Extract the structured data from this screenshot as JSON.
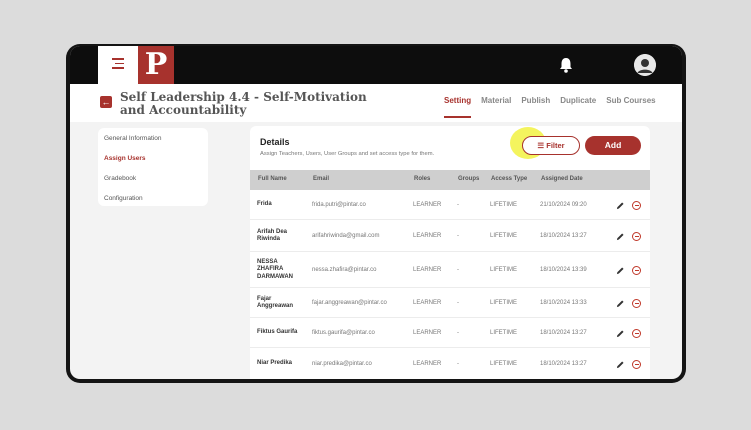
{
  "app": {
    "logo_letter": "P",
    "accent_color": "#a7322d",
    "icons": [
      "hamburger-menu-icon",
      "bell-icon",
      "user-avatar-icon",
      "back-arrow-icon",
      "filter-icon",
      "edit-pencil-icon",
      "remove-circle-icon"
    ]
  },
  "header": {
    "title": "Self Leadership 4.4 - Self-Motivation and Accountability",
    "tabs": [
      {
        "label": "Setting",
        "active": true
      },
      {
        "label": "Material",
        "active": false
      },
      {
        "label": "Publish",
        "active": false
      },
      {
        "label": "Duplicate",
        "active": false
      },
      {
        "label": "Sub Courses",
        "active": false
      }
    ]
  },
  "sidebar": {
    "items": [
      {
        "label": "General Information",
        "active": false
      },
      {
        "label": "Assign Users",
        "active": true
      },
      {
        "label": "Gradebook",
        "active": false
      },
      {
        "label": "Configuration",
        "active": false
      }
    ]
  },
  "details": {
    "title": "Details",
    "subtitle": "Assign Teachers, Users, User Groups and set access type for them.",
    "filter_label": "Filter",
    "add_label": "Add"
  },
  "table": {
    "columns": [
      "Full Name",
      "Email",
      "Roles",
      "Groups",
      "Access Type",
      "Assigned Date"
    ],
    "rows": [
      {
        "name": "Frida",
        "email": "frida.putri@pintar.co",
        "role": "LEARNER",
        "groups": "-",
        "access": "LIFETIME",
        "date": "21/10/2024 09:20"
      },
      {
        "name": "Arifah Dea Riwinda",
        "email": "arifahriwinda@gmail.com",
        "role": "LEARNER",
        "groups": "-",
        "access": "LIFETIME",
        "date": "18/10/2024 13:27"
      },
      {
        "name": "NESSA ZHAFIRA DARMAWAN",
        "email": "nessa.zhafira@pintar.co",
        "role": "LEARNER",
        "groups": "-",
        "access": "LIFETIME",
        "date": "18/10/2024 13:39"
      },
      {
        "name": "Fajar Anggreawan",
        "email": "fajar.anggreawan@pintar.co",
        "role": "LEARNER",
        "groups": "-",
        "access": "LIFETIME",
        "date": "18/10/2024 13:33"
      },
      {
        "name": "Fiktus Gaurifa",
        "email": "fiktus.gaurifa@pintar.co",
        "role": "LEARNER",
        "groups": "-",
        "access": "LIFETIME",
        "date": "18/10/2024 13:27"
      },
      {
        "name": "Niar Predika",
        "email": "niar.predika@pintar.co",
        "role": "LEARNER",
        "groups": "-",
        "access": "LIFETIME",
        "date": "18/10/2024 13:27"
      }
    ]
  }
}
